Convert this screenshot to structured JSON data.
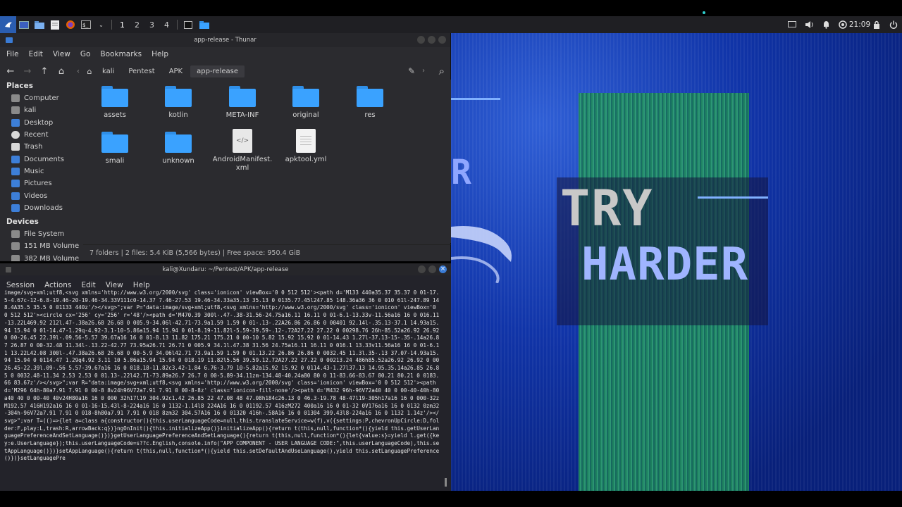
{
  "panel": {
    "workspaces": [
      "1",
      "2",
      "3",
      "4"
    ],
    "clock": "21:09",
    "icons": [
      "app-menu-icon",
      "desktop-icon",
      "files-icon",
      "text-editor-icon",
      "firefox-icon",
      "terminal-icon",
      "thunar-task-icon",
      "display-icon",
      "volume-icon",
      "notifications-icon",
      "network-icon",
      "lock-icon",
      "power-icon"
    ]
  },
  "thunar": {
    "title": "app-release - Thunar",
    "menu": [
      "File",
      "Edit",
      "View",
      "Go",
      "Bookmarks",
      "Help"
    ],
    "breadcrumb": [
      "kali",
      "Pentest",
      "APK",
      "app-release"
    ],
    "sidebar": {
      "places_heading": "Places",
      "places": [
        "Computer",
        "kali",
        "Desktop",
        "Recent",
        "Trash",
        "Documents",
        "Music",
        "Pictures",
        "Videos",
        "Downloads"
      ],
      "devices_heading": "Devices",
      "devices": [
        "File System",
        "151 MB Volume",
        "382 MB Volume"
      ]
    },
    "files": [
      {
        "name": "assets",
        "type": "folder"
      },
      {
        "name": "kotlin",
        "type": "folder"
      },
      {
        "name": "META-INF",
        "type": "folder"
      },
      {
        "name": "original",
        "type": "folder"
      },
      {
        "name": "res",
        "type": "folder"
      },
      {
        "name": "smali",
        "type": "folder"
      },
      {
        "name": "unknown",
        "type": "folder"
      },
      {
        "name": "AndroidManifest.xml",
        "type": "xml"
      },
      {
        "name": "apktool.yml",
        "type": "text"
      }
    ],
    "status": "7 folders  |  2 files: 5.4 KiB (5,566 bytes)  |  Free space: 950.4 GiB"
  },
  "terminal": {
    "title": "kali@Xundaru: ~/Pentest/APK/app-release",
    "menu": [
      "Session",
      "Actions",
      "Edit",
      "View",
      "Help"
    ],
    "content": "image/svg+xml;utf8,<svg xmlns='http://www.w3.org/2000/svg' class='ionicon' viewBox='0 0 512 512'><path d='M133 440a35.37 35.37 0 01-17.5-4.67c-12-6.8-19.46-20-19.46-34.33V111c0-14.37 7.46-27.53 19.46-34.33a35.13 35.13 0 0135.77.45l247.85 148.36a36 36 0 010 61l-247.89 148.4A35.5 35.5 0 01133 440z'/></svg>\";var P=\"data:image/svg+xml;utf8,<svg xmlns='http://www.w3.org/2000/svg' class='ionicon' viewBox='0 0 512 512'><circle cx='256' cy='256' r='48'/><path d='M470.39 300l-.47-.38-31.56-24.75a16.11 16.11 0 01-6.1-13.33v-11.56a16 16 0 016.11-13.22L469.92 212l.47-.38a26.68 26.68 0 005.9-34.06l-42.71-73.9a1.59 1.59 0 01-.13-.22A26.86 26.86 0 00401 92.14l-.35.13-37.1 14.93a15.94 15.94 0 01-14.47-1.29q-4.92-3.1-10-5.86a15.94 15.94 0 01-8.19-11.82l-5.59-39.59-.12-.72A27.22 27.22 0 00298.76 26h-85.52a26.92 26.92 0 00-26.45 22.39l-.09.56-5.57 39.67a16 16 0 01-8.13 11.82 175.21 175.21 0 00-10 5.82 15.92 15.92 0 01-14.43 1.27l-37.13-15-.35-.14a26.87 26.87 0 00-32.48 11.34l-.13.22-42.77 73.95a26.71 26.71 0 005.9 34.1l.47.38 31.56 24.75a16.11 16.11 0 016.1 13.33v11.56a16 16 0 01-6.11 13.22L42.08 300l-.47.38a26.68 26.68 0 00-5.9 34.06l42.71 73.9a1.59 1.59 0 01.13.22 26.86 26.86 0 0032.45 11.3l.35-.13 37.07-14.93a15.94 15.94 0 0114.47 1.29q4.92 3.11 10 5.86a15.94 15.94 0 018.19 11.82l5.56 39.59.12.72A27.22 27.22 0 00213.24 486h85.52a26.92 26.92 0 0026.45-22.39l.09-.56 5.57-39.67a16 16 0 018.18-11.82c3.42-1.84 6.76-3.79 10-5.82a15.92 15.92 0 0114.43-1.27l37.13 14.95.35.14a26.85 26.85 0 0032.48-11.34 2.53 2.53 0 01.13-.22l42.71-73.89a26.7 26.7 0 00-5.89-34.11zm-134.48-40.24a80 80 0 11-83.66-83.67 80.21 80.21 0 0183.66 83.67z'/></svg>\";var R=\"data:image/svg+xml;utf8,<svg xmlns='http://www.w3.org/2000/svg' class='ionicon' viewBox='0 0 512 512'><path d='M296 64h-80a7.91 7.91 0 00-8 8v24h96V72a7.91 7.91 0 00-8-8z' class='ionicon-fill-none'/><path d='M432 96h-96V72a40 40 0 00-40-40h-80a40 40 0 00-40 40v24H80a16 16 0 000 32h17l19 304.92c1.42 26.85 22 47.08 48 47.08h184c26.13 0 46.3-19.78 48-47l19-305h17a16 16 0 000-32zM192.57 416H192a16 16 0 01-16-15.43l-8-224a16 16 0 1132-1.14l8 224A16 16 0 01192.57 416zM272 400a16 16 0 01-32 0V176a16 16 0 0132 0zm32-304h-96V72a7.91 7.91 0 018-8h80a7.91 7.91 0 018 8zm32 304.57A16 16 0 01320 416h-.58A16 16 0 01304 399.43l8-224a16 16 0 1132 1.14z'/></svg>\";var T=(()=>{let a=class a{constructor(){this.userLanguageCode=null,this.translateService=w(f),v({settings:P,chevronUpCircle:D,folder:F,play:L,trash:R,arrowBack:q})}ngOnInit(){this.initializeApp()}initializeApp(){return t(this,null,function*(){yield this.getUserLanguagePreferenceAndSetLanguage()})}getUserLanguagePreferenceAndSetLanguage(){return t(this,null,function*(){let{value:s}=yield l.get({key:e.UserLanguage});this.userLanguageCode=s??c.English,console.info(\"APP COMPONENT - USER LANGUAGE CODE:\",this.userLanguageCode),this.setAppLanguage()})}setAppLanguage(){return t(this,null,function*(){yield this.setDefaultAndUseLanguage(),yield this.setLanguagePreference()})}setLanguagePre"
  },
  "wallpaper": {
    "line1": "TRY",
    "line2": "HARDER",
    "fragment": "R"
  },
  "colors": {
    "accent": "#3a7bd5",
    "folder": "#3aa2ff",
    "panel_bg": "#1f1f23",
    "window_bg": "#2b2b2f"
  }
}
